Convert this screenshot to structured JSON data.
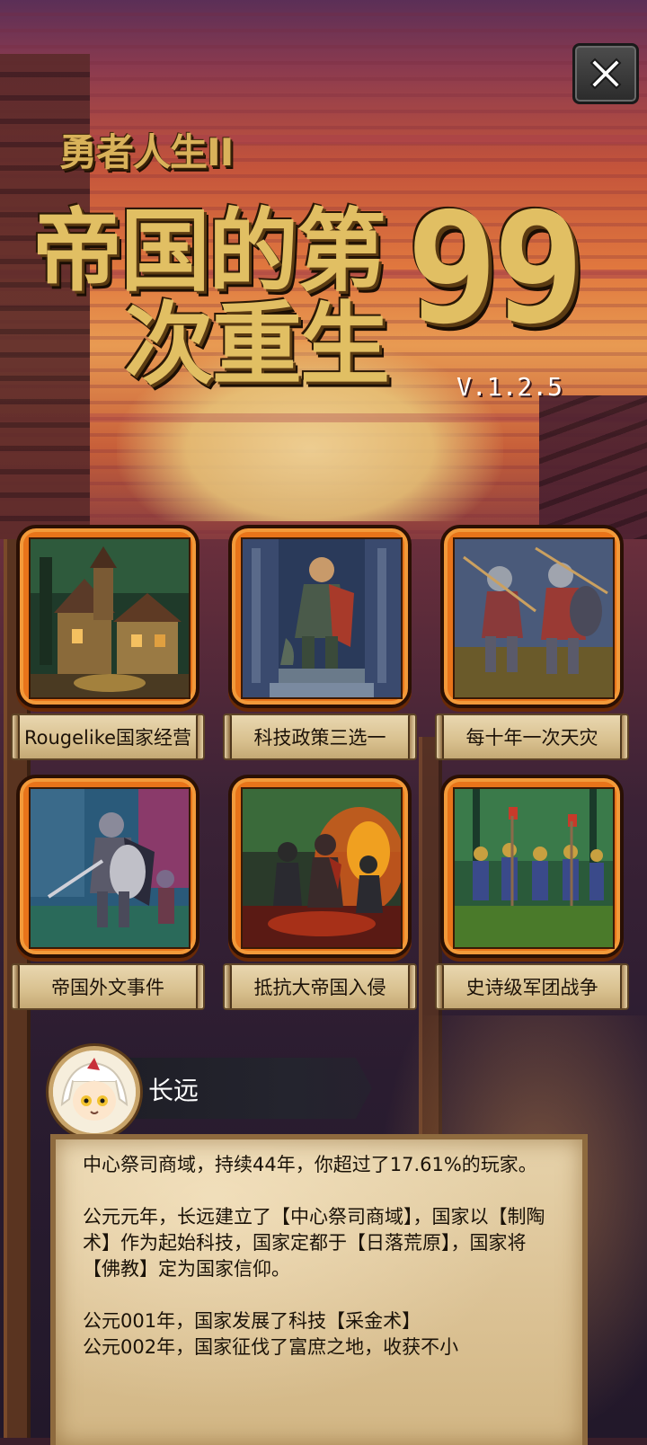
{
  "game": {
    "subtitle": "勇者人生II",
    "title_line1": "帝国的第",
    "title_line2": "次重生",
    "title_number": "99",
    "version": "V.1.2.5"
  },
  "close_button": {
    "icon": "close-icon"
  },
  "features": [
    {
      "label": "Rougelike国家经营",
      "art": "medieval-town"
    },
    {
      "label": "科技政策三选一",
      "art": "knight-statue"
    },
    {
      "label": "每十年一次天灾",
      "art": "charging-soldiers"
    },
    {
      "label": "帝国外文事件",
      "art": "knight-with-shield"
    },
    {
      "label": "抵抗大帝国入侵",
      "art": "burning-battle"
    },
    {
      "label": "史诗级军团战争",
      "art": "marching-army"
    }
  ],
  "player": {
    "name": "长远",
    "avatar": "chibi-avatar"
  },
  "log": {
    "summary": "中心祭司商域，持续44年，你超过了17.61%的玩家。",
    "entry1": "公元元年，长远建立了【中心祭司商域】，国家以【制陶术】作为起始科技，国家定都于【日落荒原】，国家将【佛教】定为国家信仰。",
    "entry2": "公元001年，国家发展了科技【采金术】",
    "entry3": "公元002年，国家征伐了富庶之地，收获不小"
  },
  "colors": {
    "title_gold": "#e1bf63",
    "card_orange": "#e8741a",
    "parchment": "#dcc396",
    "close_button_bg": "#3a3a3a"
  }
}
